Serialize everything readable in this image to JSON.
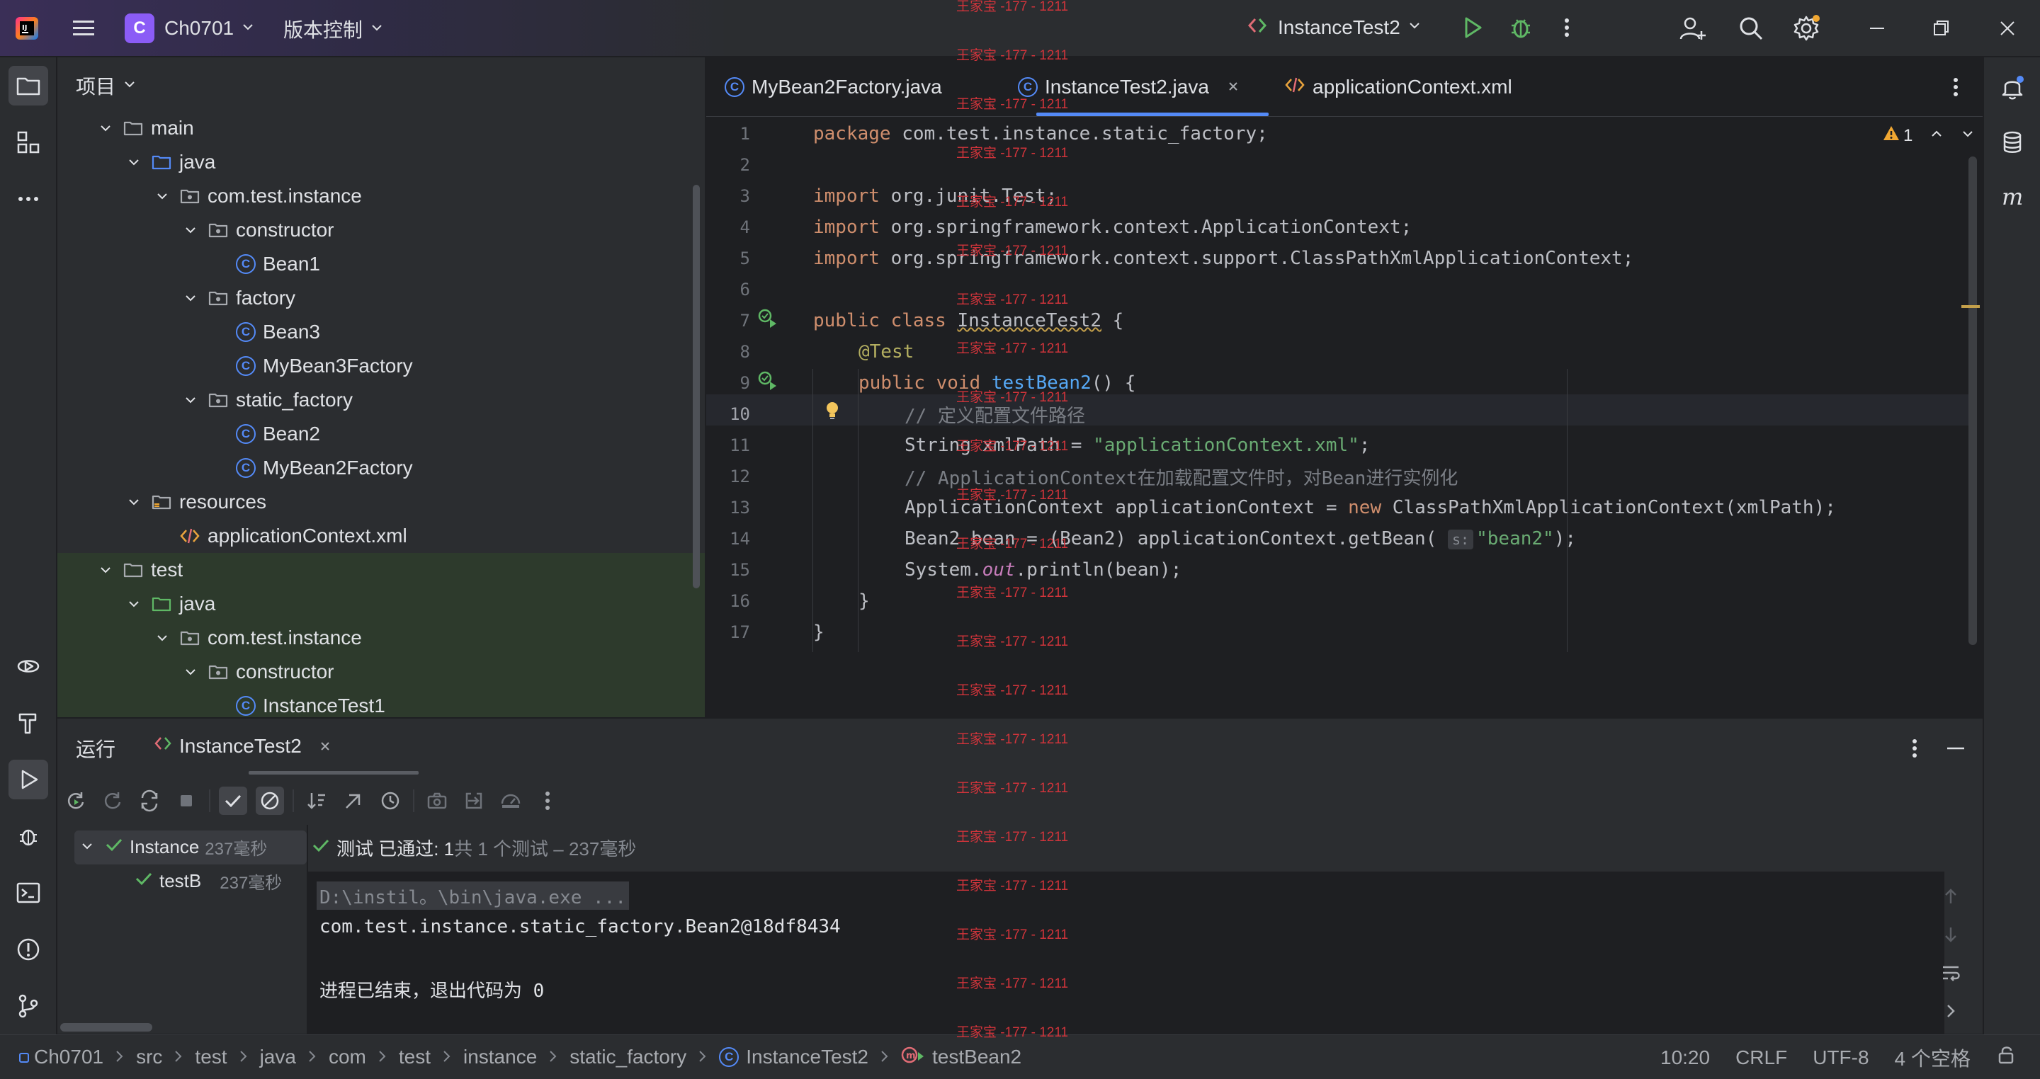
{
  "titlebar": {
    "project_badge": "C",
    "project_name": "Ch0701",
    "vcs_label": "版本控制",
    "run_config": "InstanceTest2"
  },
  "project_panel": {
    "title": "项目",
    "tree": [
      {
        "label": "main",
        "type": "folder"
      },
      {
        "label": "java",
        "type": "src-folder"
      },
      {
        "label": "com.test.instance",
        "type": "package"
      },
      {
        "label": "constructor",
        "type": "package"
      },
      {
        "label": "Bean1",
        "type": "class"
      },
      {
        "label": "factory",
        "type": "package"
      },
      {
        "label": "Bean3",
        "type": "class"
      },
      {
        "label": "MyBean3Factory",
        "type": "class"
      },
      {
        "label": "static_factory",
        "type": "package"
      },
      {
        "label": "Bean2",
        "type": "class"
      },
      {
        "label": "MyBean2Factory",
        "type": "class"
      },
      {
        "label": "resources",
        "type": "res-folder"
      },
      {
        "label": "applicationContext.xml",
        "type": "xml"
      },
      {
        "label": "test",
        "type": "folder"
      },
      {
        "label": "java",
        "type": "test-folder"
      },
      {
        "label": "com.test.instance",
        "type": "package"
      },
      {
        "label": "constructor",
        "type": "package"
      },
      {
        "label": "InstanceTest1",
        "type": "class"
      }
    ]
  },
  "editor": {
    "tabs": [
      {
        "label": "MyBean2Factory.java",
        "active": false
      },
      {
        "label": "InstanceTest2.java",
        "active": true
      },
      {
        "label": "applicationContext.xml",
        "active": false
      }
    ],
    "warning_count": "1",
    "line_numbers": [
      "1",
      "2",
      "3",
      "4",
      "5",
      "6",
      "7",
      "8",
      "9",
      "10",
      "11",
      "12",
      "13",
      "14",
      "15",
      "16",
      "17"
    ],
    "code": {
      "l1_kw": "package",
      "l1_rest": " com.test.instance.static_factory;",
      "l3_kw": "import",
      "l3_rest": " org.junit.Test;",
      "l4_kw": "import",
      "l4_rest": " org.springframework.context.ApplicationContext;",
      "l5_kw": "import",
      "l5_rest": " org.springframework.context.support.ClassPathXmlApplicationContext;",
      "l7_kw": "public class ",
      "l7_name": "InstanceTest2",
      "l7_rest": " {",
      "l8_ann": "@Test",
      "l9_kw": "public void ",
      "l9_fn": "testBean2",
      "l9_rest": "() {",
      "l10_cmt": "// 定义配置文件路径",
      "l11_a": "String xmlPath = ",
      "l11_str": "\"applicationContext.xml\"",
      "l11_b": ";",
      "l12_cmt": "// ApplicationContext在加载配置文件时，对Bean进行实例化",
      "l13_a": "ApplicationContext applicationContext = ",
      "l13_kw": "new",
      "l13_b": " ClassPathXmlApplicationContext(xmlPath);",
      "l14_a": "Bean2 bean = (Bean2) applicationContext.getBean( ",
      "l14_hint": "s:",
      "l14_str": "\"bean2\"",
      "l14_b": ");",
      "l15_a": "System.",
      "l15_static": "out",
      "l15_b": ".println(bean);",
      "l16": "}",
      "l17": "}"
    }
  },
  "run_panel": {
    "tab_run": "运行",
    "tab_config": "InstanceTest2",
    "tests": [
      {
        "name": "Instance",
        "time": "237毫秒"
      },
      {
        "name": "testB",
        "time": "237毫秒"
      }
    ],
    "status_passed": "测试 已通过: 1",
    "status_detail": "共 1 个测试 – 237毫秒",
    "console": [
      "D:\\instil。\\bin\\java.exe ...",
      "com.test.instance.static_factory.Bean2@18df8434",
      "",
      "进程已结束，退出代码为 0"
    ]
  },
  "statusbar": {
    "breadcrumbs": [
      "Ch0701",
      "src",
      "test",
      "java",
      "com",
      "test",
      "instance",
      "static_factory",
      "InstanceTest2",
      "testBean2"
    ],
    "position": "10:20",
    "line_sep": "CRLF",
    "encoding": "UTF-8",
    "indent": "4 个空格"
  },
  "watermark": "王家宝 -177 - 1211"
}
